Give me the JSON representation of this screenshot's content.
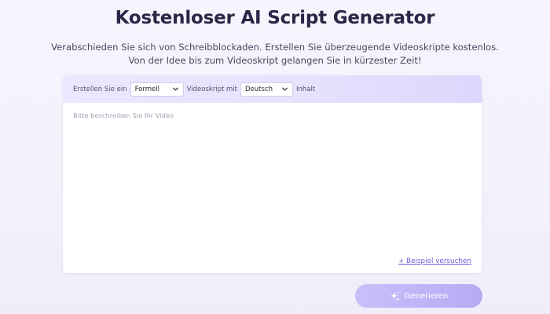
{
  "page": {
    "title": "Kostenloser AI Script Generator",
    "subtitle_line1": "Verabschieden Sie sich von Schreibblockaden. Erstellen Sie überzeugende Videoskripte kostenlos.",
    "subtitle_line2": "Von der Idee bis zum Videoskript gelangen Sie in kürzester Zeit!"
  },
  "form": {
    "prefix_text": "Erstellen Sie ein",
    "format_select": {
      "selected": "Formell"
    },
    "middle_text": "Videoskript mit",
    "language_select": {
      "selected": "Deutsch"
    },
    "suffix_text": "Inhalt",
    "description_placeholder": "Bitte beschreiben Sie Ihr Video",
    "example_link": "+ Beispiel versuchen"
  },
  "actions": {
    "generate_label": "Generieren"
  },
  "colors": {
    "title": "#2a2747",
    "accent": "#6a5bd8",
    "button_start": "#cabff9",
    "button_end": "#b7aaf5",
    "header_band": "#e7e2fe"
  },
  "icons": {
    "select_chevron": "chevron-down-icon",
    "generate": "sparkle-icon"
  }
}
